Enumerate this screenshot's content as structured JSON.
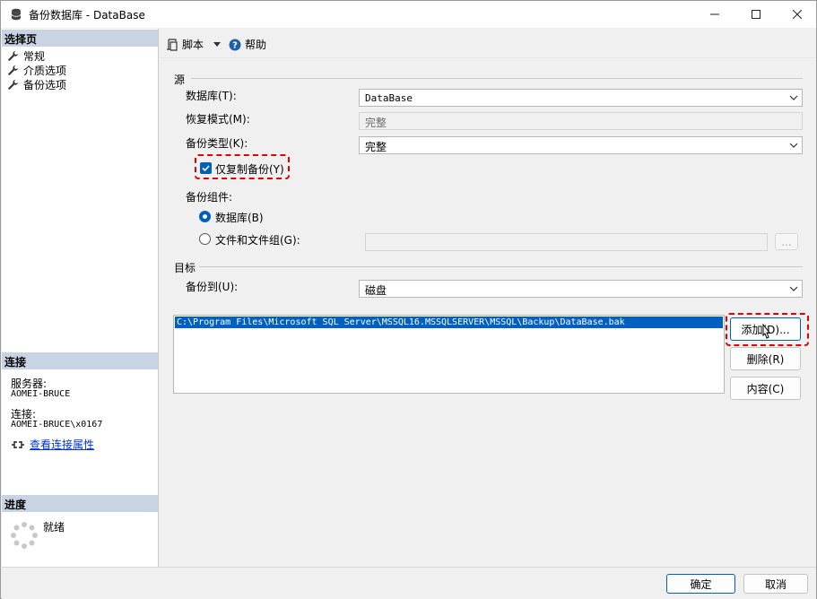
{
  "window": {
    "title": "备份数据库 - DataBase"
  },
  "left": {
    "select_page": {
      "header": "选择页",
      "items": [
        {
          "label": "常规",
          "icon": "wrench-icon"
        },
        {
          "label": "介质选项",
          "icon": "wrench-icon"
        },
        {
          "label": "备份选项",
          "icon": "wrench-icon"
        }
      ]
    },
    "connection": {
      "header": "连接",
      "server_label": "服务器:",
      "server_value": "AOMEI-BRUCE",
      "conn_label": "连接:",
      "conn_value": "AOMEI-BRUCE\\x0167",
      "view_props": "查看连接属性"
    },
    "progress": {
      "header": "进度",
      "status": "就绪"
    }
  },
  "toolbar": {
    "script": "脚本",
    "help": "帮助"
  },
  "source": {
    "group": "源",
    "database_label": "数据库(T):",
    "database_value": "DataBase",
    "recovery_label": "恢复模式(M):",
    "recovery_value": "完整",
    "backup_type_label": "备份类型(K):",
    "backup_type_value": "完整",
    "copy_only_label": "仅复制备份(Y)",
    "component_label": "备份组件:",
    "radio_database": "数据库(B)",
    "radio_files": "文件和文件组(G):",
    "files_browse": "..."
  },
  "destination": {
    "group": "目标",
    "backup_to_label": "备份到(U):",
    "backup_to_value": "磁盘",
    "paths": [
      "C:\\Program Files\\Microsoft SQL Server\\MSSQL16.MSSQLSERVER\\MSSQL\\Backup\\DataBase.bak"
    ],
    "add_button": "添加(D)...",
    "remove_button": "删除(R)",
    "contents_button": "内容(C)"
  },
  "footer": {
    "ok": "确定",
    "cancel": "取消"
  },
  "colors": {
    "accent": "#005fb8",
    "highlight": "#e00000",
    "header_bg": "#c8d4e3"
  }
}
